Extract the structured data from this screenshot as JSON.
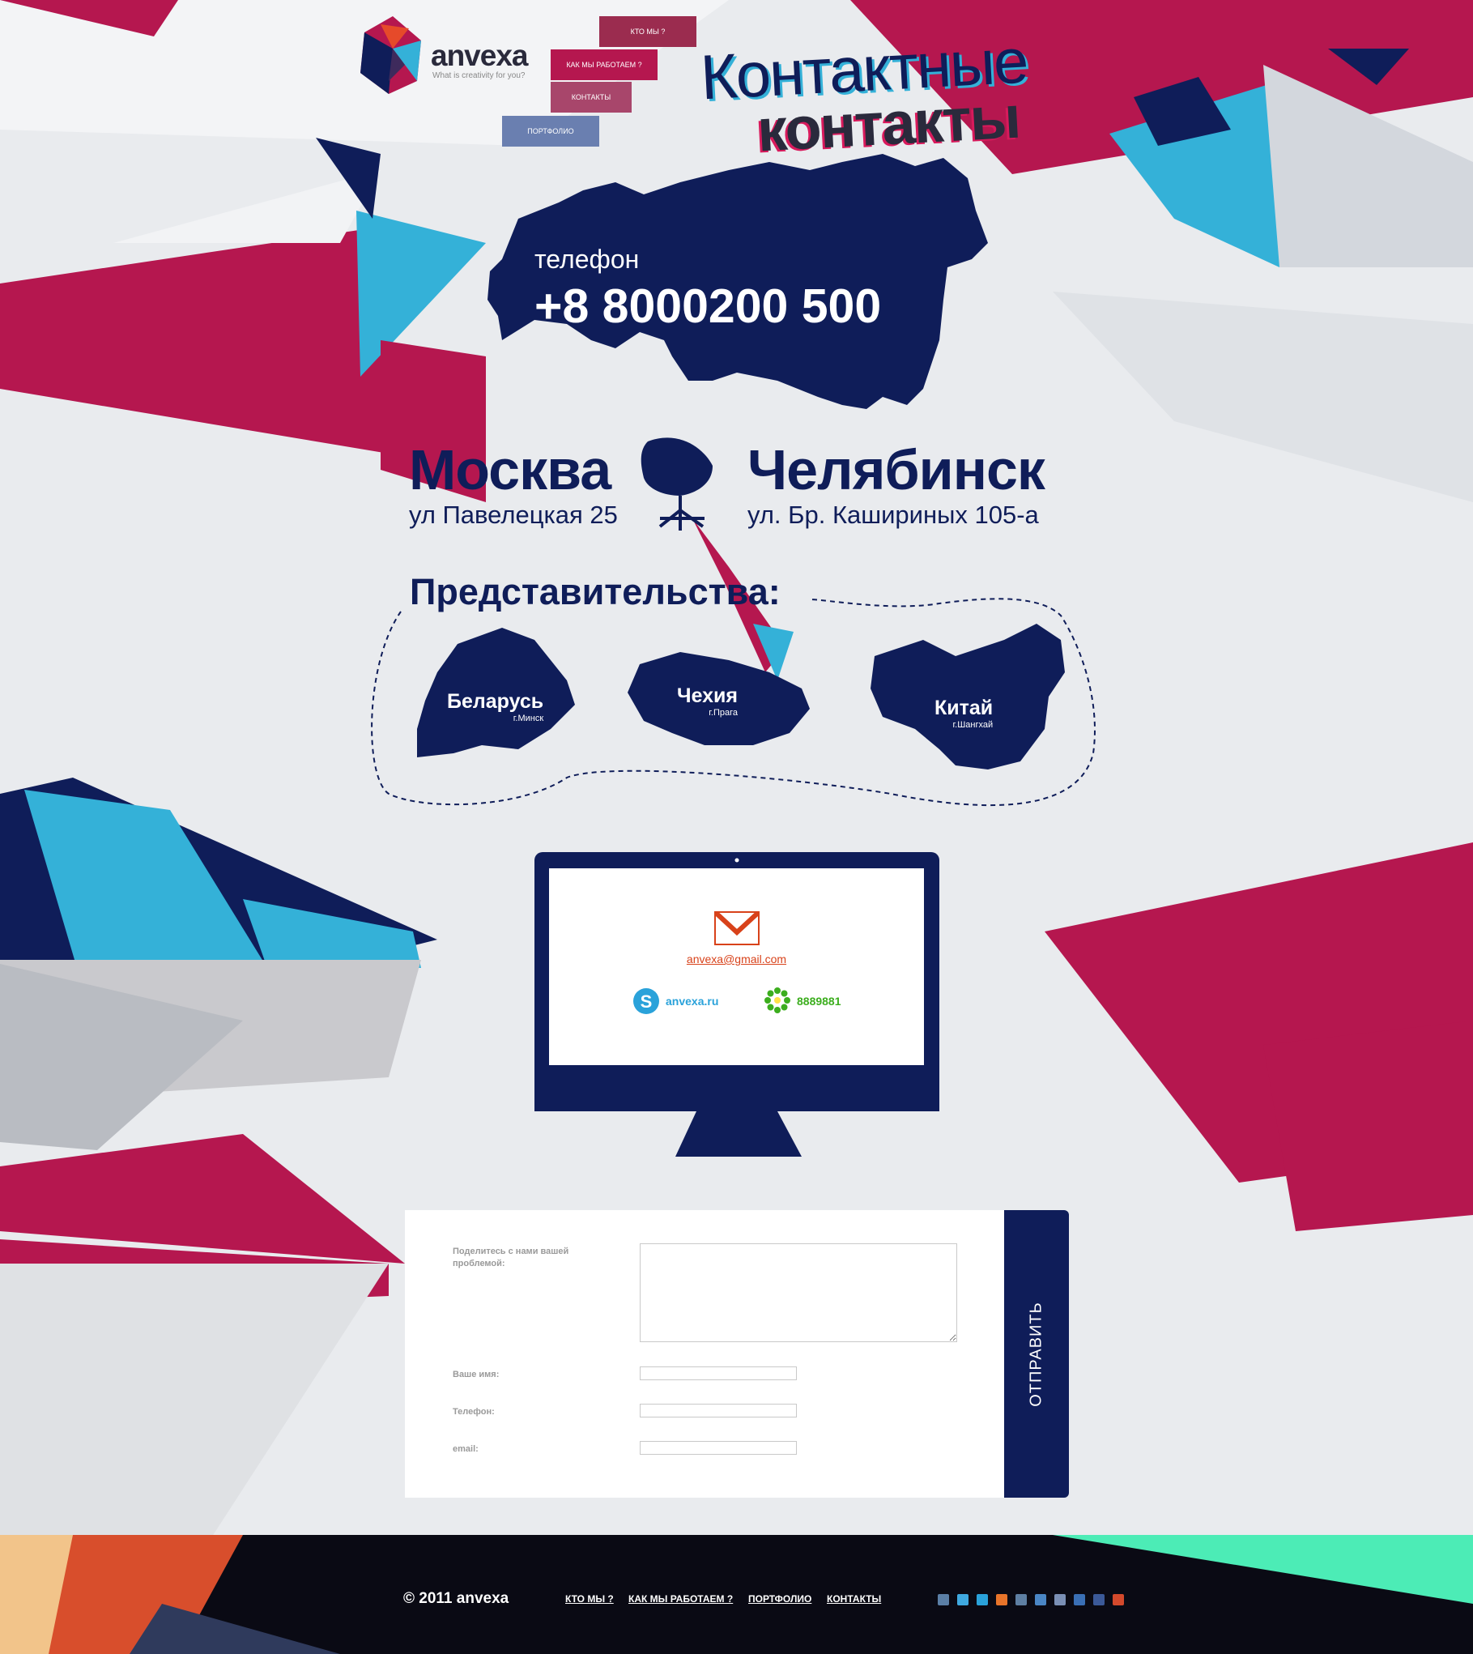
{
  "brand": {
    "name": "anvexa",
    "tagline": "What is creativity for you?"
  },
  "nav": [
    "КТО МЫ ?",
    "КАК МЫ РАБОТАЕМ ?",
    "КОНТАКТЫ",
    "ПОРТФОЛИО"
  ],
  "title": {
    "line1": "Контактные",
    "line2": "контакты"
  },
  "phone": {
    "label": "телефон",
    "number": "+8 8000200 500"
  },
  "offices": [
    {
      "city": "Москва",
      "address": "ул Павелецкая 25"
    },
    {
      "city": "Челябинск",
      "address": "ул. Бр. Кашириных 105-а"
    }
  ],
  "representations": {
    "title": "Представительства:",
    "items": [
      {
        "country": "Беларусь",
        "city": "г.Минск"
      },
      {
        "country": "Чехия",
        "city": "г.Прага"
      },
      {
        "country": "Китай",
        "city": "г.Шангхай"
      }
    ]
  },
  "contacts": {
    "email": "anvexa@gmail.com",
    "skype": "anvexa.ru",
    "icq": "8889881"
  },
  "form": {
    "problem_label": "Поделитесь с нами вашей проблемой:",
    "name_label": "Ваше имя:",
    "phone_label": "Телефон:",
    "email_label": "email:",
    "submit": "ОТПРАВИТЬ"
  },
  "footer": {
    "copyright": "© 2011 anvexa",
    "links": [
      "КТО МЫ ?",
      "КАК МЫ РАБОТАЕМ ?",
      "ПОРТФОЛИО",
      "КОНТАКТЫ"
    ],
    "social_icons": [
      "vkontakte-icon",
      "twitter-icon",
      "skype-icon",
      "rss-icon",
      "livejournal-icon",
      "moikrug-icon",
      "odnoklassniki-icon",
      "flickr-icon",
      "facebook-icon",
      "googleplus-icon"
    ]
  },
  "colors": {
    "navy": "#0f1d59",
    "crimson": "#b5174f",
    "cyan": "#34b1d8",
    "green_accent": "#4cecb6"
  }
}
